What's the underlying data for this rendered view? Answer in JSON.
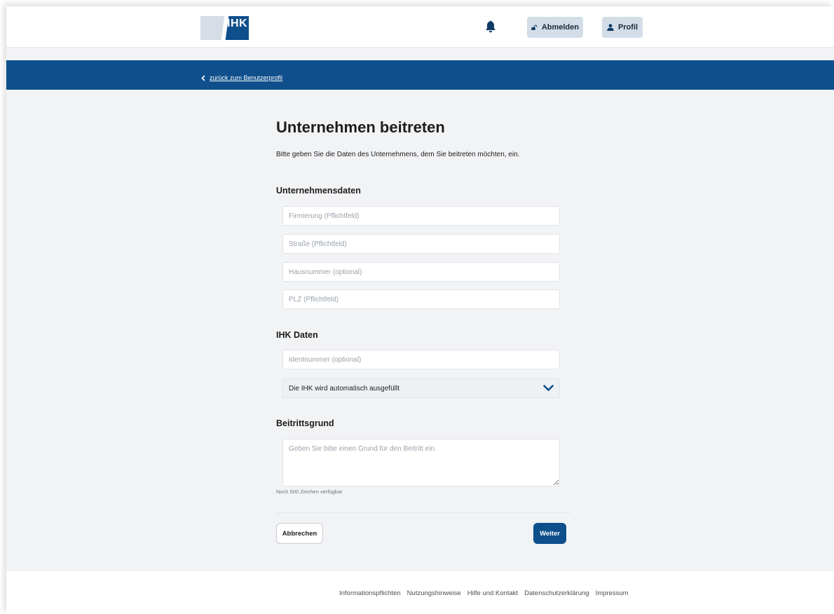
{
  "header": {
    "logo_text": "IHK",
    "logout_label": "Abmelden",
    "profile_label": "Profil",
    "icons": {
      "bell": "bell-icon",
      "logout": "unlock-icon",
      "profile": "user-icon"
    }
  },
  "nav": {
    "back_label": "zurück zum Benutzerprofil",
    "back_icon": "chevron-left-icon"
  },
  "main": {
    "title": "Unternehmen beitreten",
    "intro": "Bitte geben Sie die Daten des Unternehmens, dem Sie beitreten möchten, ein.",
    "company_section": {
      "title": "Unternehmensdaten",
      "firm_placeholder": "Firmierung (Pflichtfeld)",
      "street_placeholder": "Straße (Pflichtfeld)",
      "housenumber_placeholder": "Hausnummer (optional)",
      "zip_placeholder": "PLZ (Pflichtfeld)"
    },
    "ihk_section": {
      "title": "IHK Daten",
      "ident_placeholder": "Identnummer (optional)",
      "ihk_select_value": "Die IHK wird automatisch ausgefüllt"
    },
    "reason_section": {
      "title": "Beitrittsgrund",
      "reason_placeholder": "Geben Sie bitte einen Grund für den Beitritt ein.",
      "counter": "Noch 500 Zeichen verfügbar"
    },
    "actions": {
      "cancel_label": "Abbrechen",
      "next_label": "Weiter"
    }
  },
  "footer": {
    "links": [
      "Informationspflichten",
      "Nutzungshinweise",
      "Hilfe und Kontakt",
      "Datenschutzerklärung",
      "Impressum"
    ]
  },
  "colors": {
    "brand_blue": "#0e4f8c",
    "button_light": "#d2dde8",
    "background": "#f2f3f5"
  }
}
